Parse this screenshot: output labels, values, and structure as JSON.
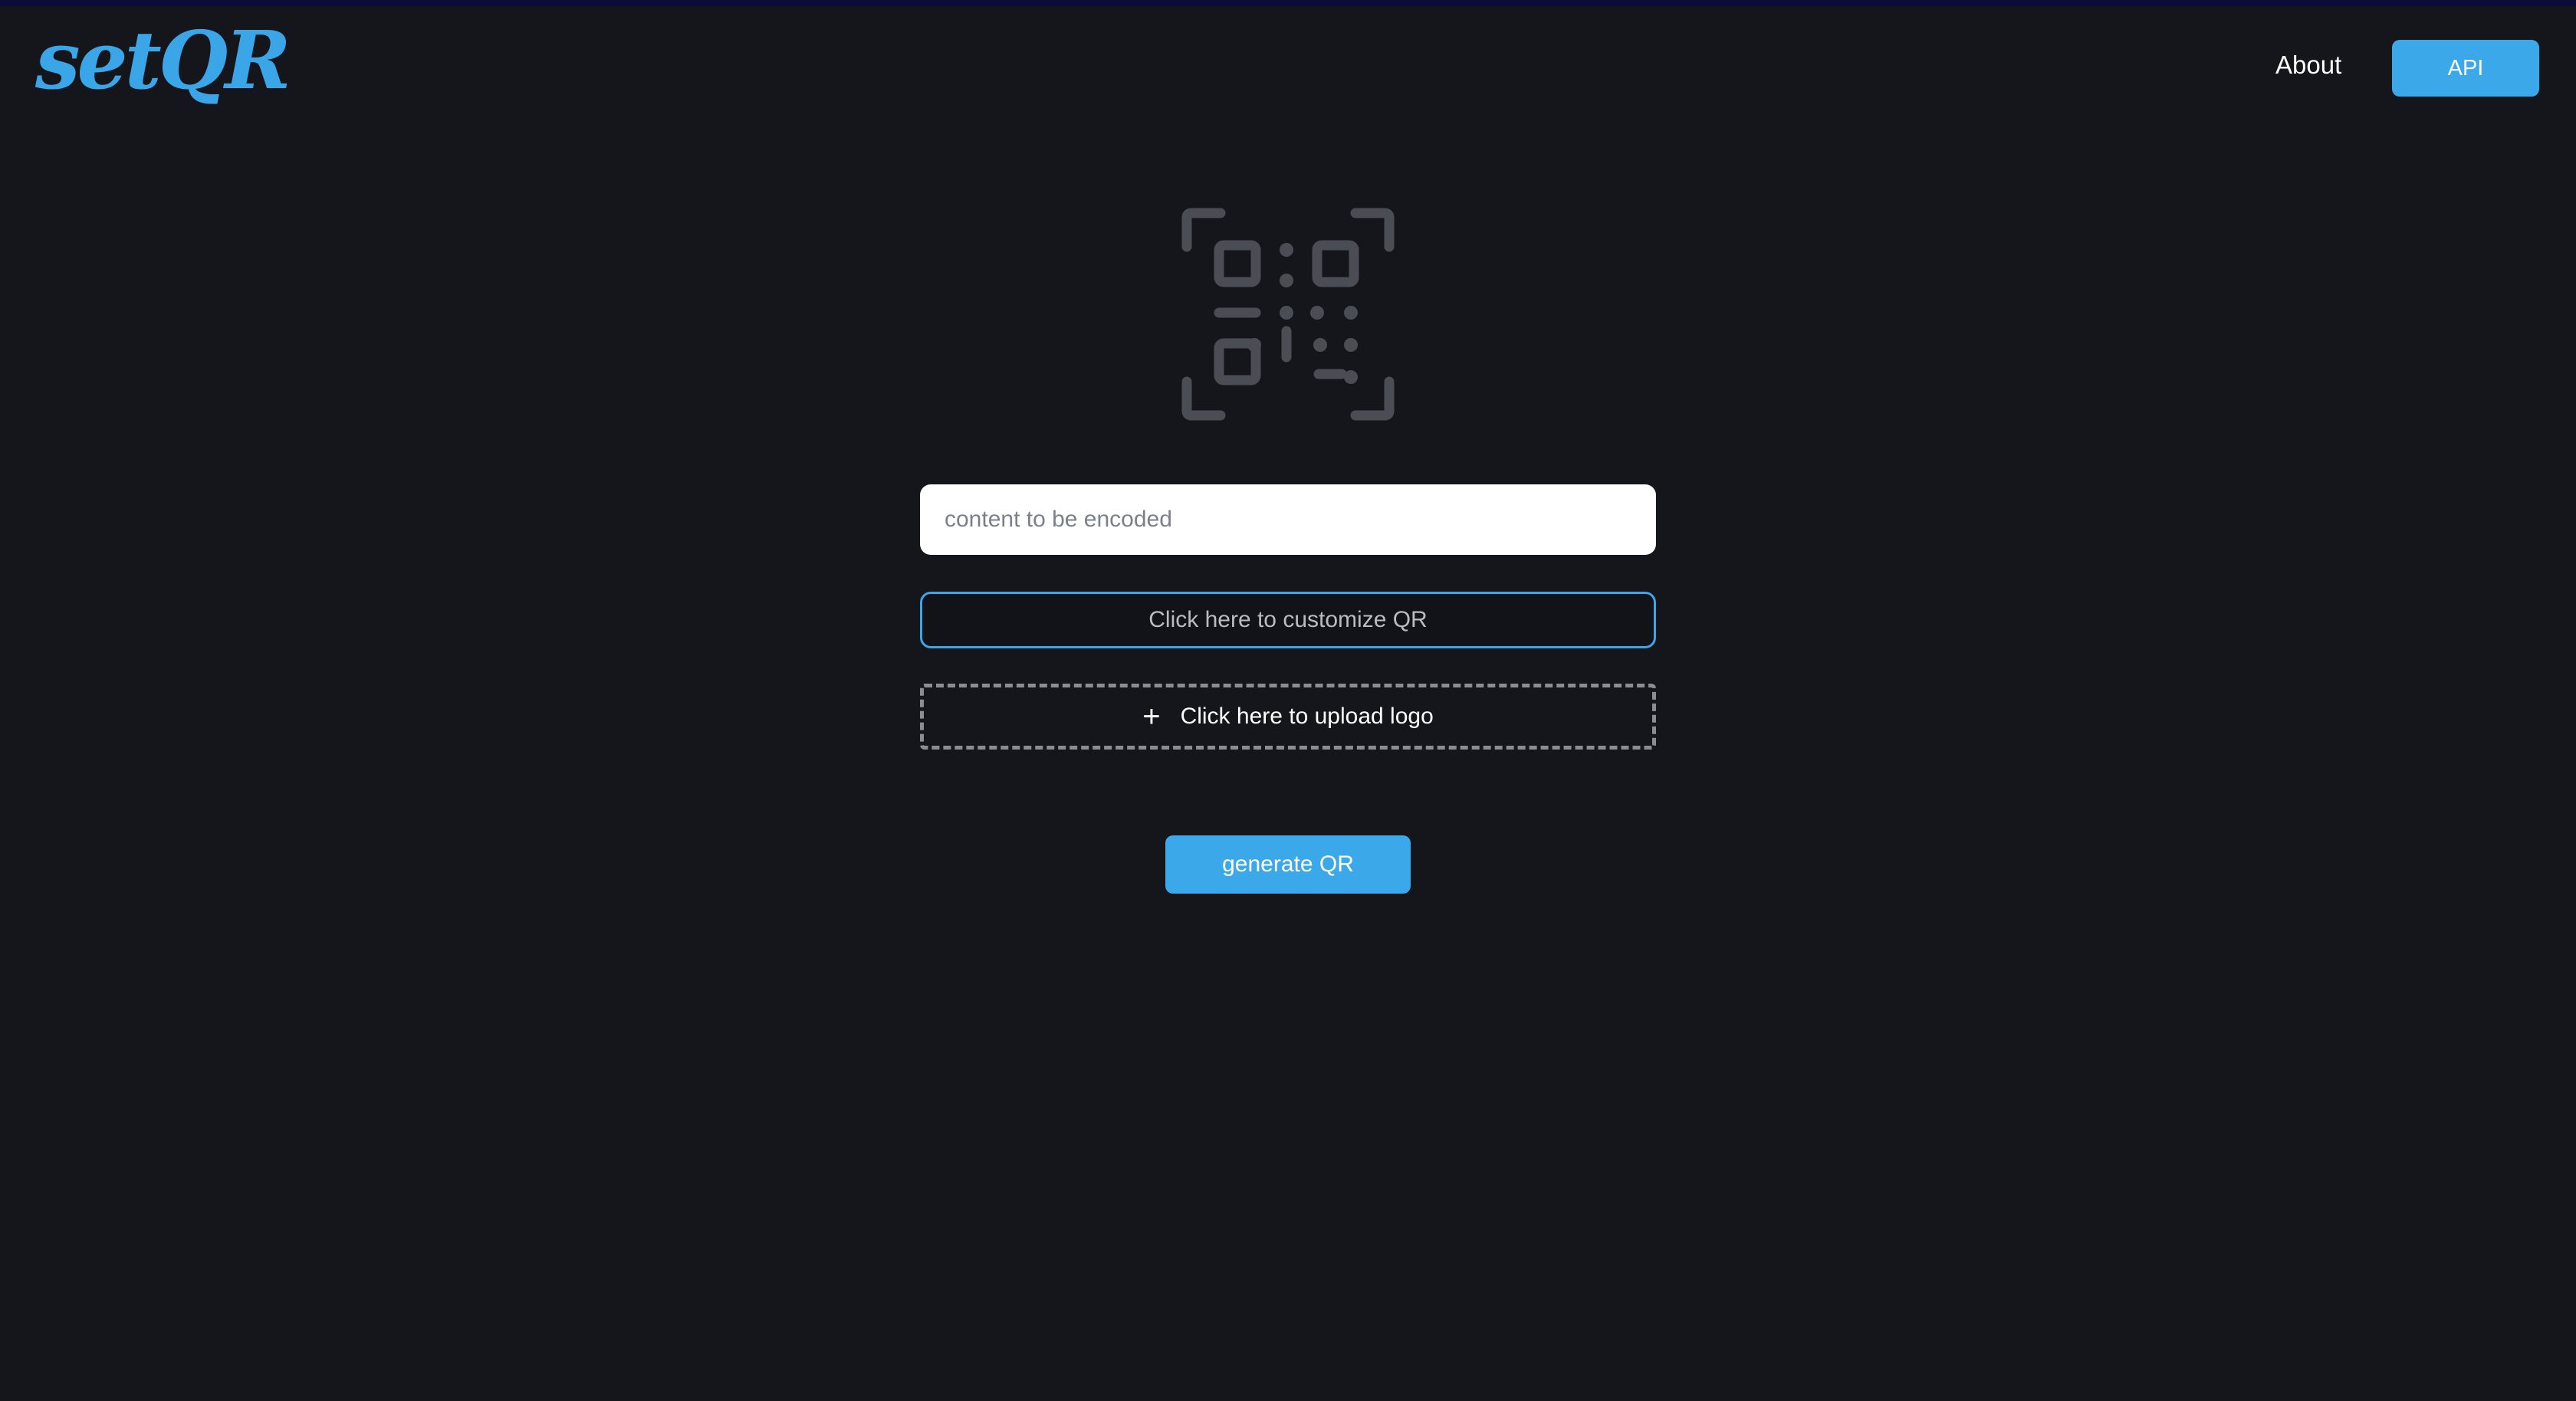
{
  "brand": {
    "logo_text": "setQR",
    "accent_color": "#3aa6e8"
  },
  "nav": {
    "about_label": "About",
    "api_label": "API"
  },
  "main": {
    "hero_icon": "qr-code-scan-icon",
    "content_input": {
      "placeholder": "content to be encoded",
      "value": ""
    },
    "customize_label": "Click here to customize QR",
    "upload": {
      "icon": "plus-icon",
      "label": "Click here to upload logo"
    },
    "generate_label": "generate QR"
  }
}
